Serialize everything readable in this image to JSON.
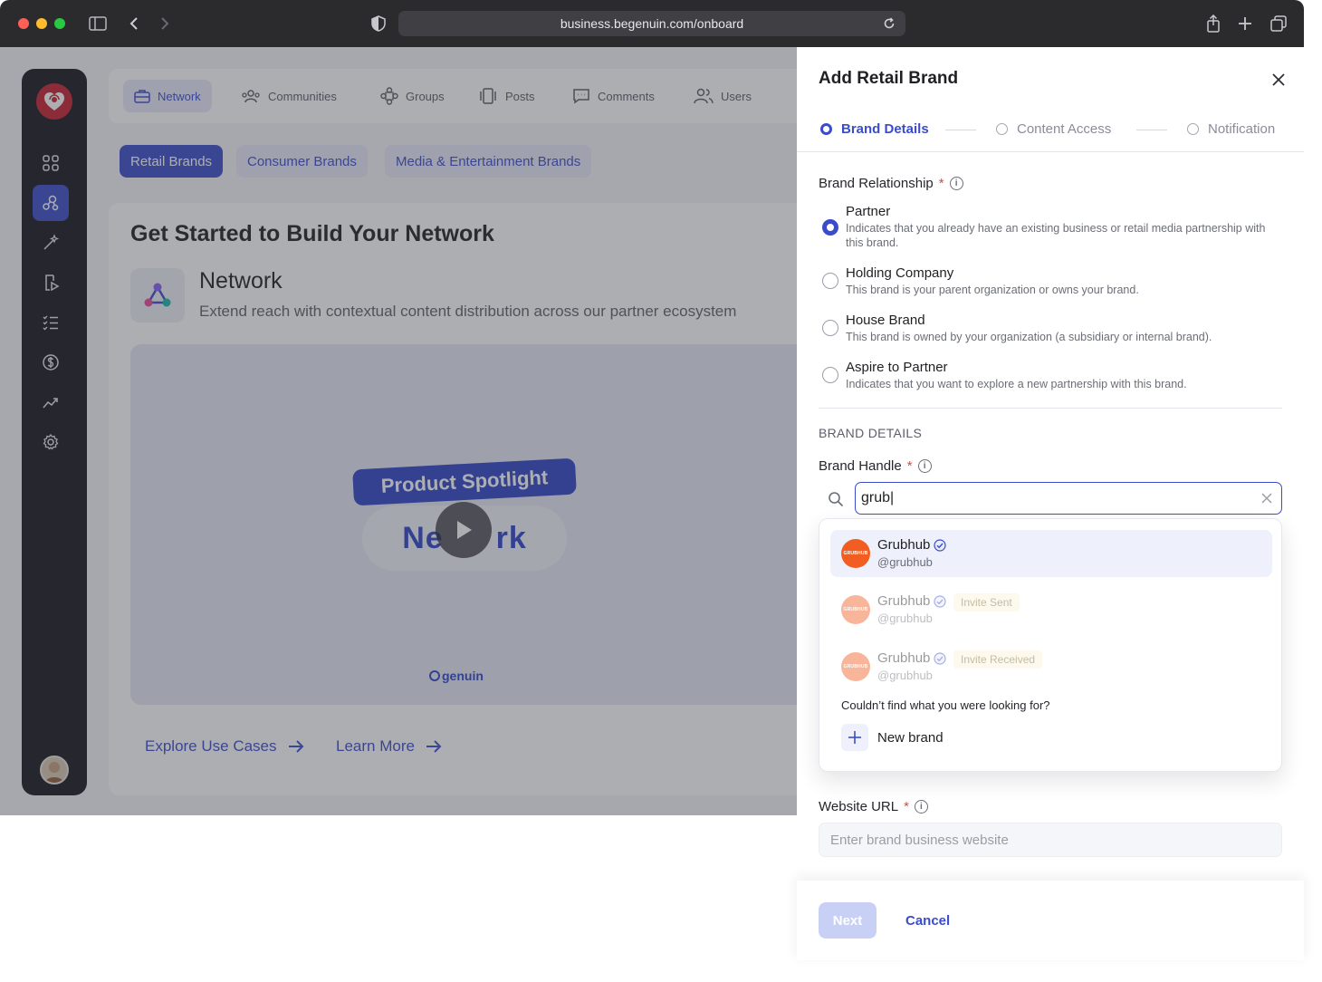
{
  "browser": {
    "url": "business.begenuin.com/onboard"
  },
  "topnav": {
    "items": [
      {
        "label": "Network",
        "icon": "briefcase-icon"
      },
      {
        "label": "Communities",
        "icon": "people-icon"
      },
      {
        "label": "Groups",
        "icon": "groups-icon"
      },
      {
        "label": "Posts",
        "icon": "posts-icon"
      },
      {
        "label": "Comments",
        "icon": "comment-icon"
      },
      {
        "label": "Users",
        "icon": "users-icon"
      }
    ]
  },
  "brand_tabs": [
    "Retail Brands",
    "Consumer Brands",
    "Media & Entertainment Brands"
  ],
  "card": {
    "title": "Get Started to Build Your Network",
    "network_title": "Network",
    "network_subtitle": "Extend reach with contextual content distribution across our partner ecosystem",
    "video_banner": "Product Spotlight",
    "video_word_left": "Ne",
    "video_word_right": "rk",
    "video_logo": "genuin",
    "explore_link": "Explore Use Cases",
    "learn_link": "Learn More"
  },
  "panel": {
    "title": "Add Retail Brand",
    "steps": [
      "Brand Details",
      "Content Access",
      "Notification"
    ],
    "relationship_label": "Brand Relationship",
    "required_mark": "*",
    "options": [
      {
        "title": "Partner",
        "desc": "Indicates that you already have an existing business or retail media partnership with this brand.",
        "checked": true
      },
      {
        "title": "Holding Company",
        "desc": "This brand is your parent organization or owns your brand.",
        "checked": false
      },
      {
        "title": "House Brand",
        "desc": "This brand is owned by your organization (a subsidiary or internal brand).",
        "checked": false
      },
      {
        "title": "Aspire to Partner",
        "desc": "Indicates that you want to explore a new partnership with this brand.",
        "checked": false
      }
    ],
    "section_heading": "BRAND DETAILS",
    "handle_label": "Brand Handle",
    "search_value": "grub|",
    "results": [
      {
        "name": "Grubhub",
        "handle": "@grubhub",
        "badge": "",
        "avatar_text": "GRUBHUB"
      },
      {
        "name": "Grubhub",
        "handle": "@grubhub",
        "badge": "Invite Sent",
        "avatar_text": "GRUBHUB"
      },
      {
        "name": "Grubhub",
        "handle": "@grubhub",
        "badge": "Invite Received",
        "avatar_text": "GRUBHUB"
      }
    ],
    "not_found_text": "Couldn’t find what you were looking for?",
    "new_brand_label": "New brand",
    "website_label": "Website URL",
    "website_placeholder": "Enter brand business website",
    "next_label": "Next",
    "cancel_label": "Cancel"
  },
  "colors": {
    "accent": "#3b4cca",
    "grubhub_orange": "#f25d21",
    "required_red": "#e0483a"
  }
}
